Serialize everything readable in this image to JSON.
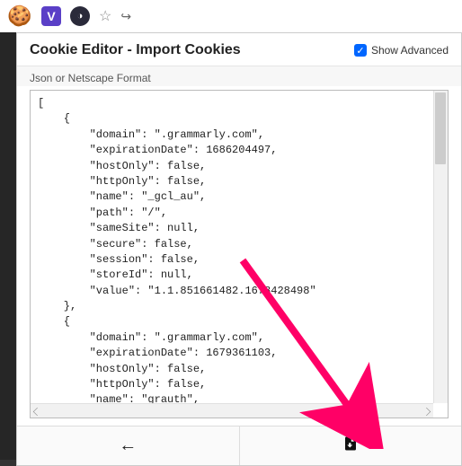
{
  "header": {
    "title": "Cookie Editor - Import Cookies",
    "advanced_label": "Show Advanced"
  },
  "label": "Json or Netscape Format",
  "json_text": "[\n    {\n        \"domain\": \".grammarly.com\",\n        \"expirationDate\": 1686204497,\n        \"hostOnly\": false,\n        \"httpOnly\": false,\n        \"name\": \"_gcl_au\",\n        \"path\": \"/\",\n        \"sameSite\": null,\n        \"secure\": false,\n        \"session\": false,\n        \"storeId\": null,\n        \"value\": \"1.1.851661482.1678428498\"\n    },\n    {\n        \"domain\": \".grammarly.com\",\n        \"expirationDate\": 1679361103,\n        \"hostOnly\": false,\n        \"httpOnly\": false,\n        \"name\": \"grauth\",\n        \"path\": \"/\",\n        \"sameSite\": null,\n        \"secure\": false,",
  "icons": {
    "v_badge": "V",
    "circ_badge": "◑"
  }
}
